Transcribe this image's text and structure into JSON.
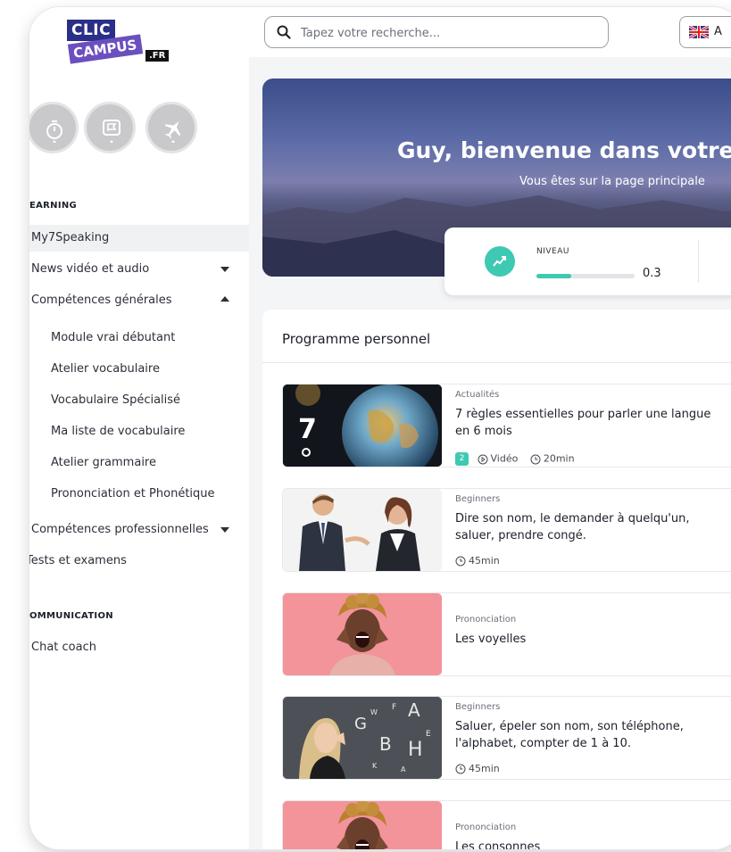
{
  "colors": {
    "accent": "#3ec9b2",
    "logo_blue": "#2a2f87",
    "logo_purple": "#6b4fbf"
  },
  "logo": {
    "line1": "CLIC",
    "line2": "CAMPUS",
    "suffix": ".FR"
  },
  "badges": [
    "timer-icon",
    "flag-icon",
    "plane-icon"
  ],
  "sidebar": {
    "section1": "EARNING",
    "items": [
      {
        "label": "My7Speaking",
        "active": true
      },
      {
        "label": "News vidéo et audio",
        "caret": "down"
      },
      {
        "label": "Compétences générales",
        "caret": "up"
      },
      {
        "label": "Module vrai débutant",
        "sub": true
      },
      {
        "label": "Atelier vocabulaire",
        "sub": true
      },
      {
        "label": "Vocabulaire Spécialisé",
        "sub": true
      },
      {
        "label": "Ma liste de vocabulaire",
        "sub": true
      },
      {
        "label": "Atelier grammaire",
        "sub": true
      },
      {
        "label": "Prononciation et Phonétique",
        "sub": true
      },
      {
        "label": "Compétences professionnelles",
        "caret": "down"
      },
      {
        "label": "Tests et examens"
      }
    ],
    "section2": "OMMUNICATION",
    "items2": [
      {
        "label": "Chat coach"
      }
    ]
  },
  "search": {
    "placeholder": "Tapez votre recherche..."
  },
  "language": {
    "label": "A"
  },
  "hero": {
    "title": "Guy, bienvenue dans votre in",
    "subtitle": "Vous êtes sur la page principale"
  },
  "level": {
    "label": "NIVEAU",
    "value": "0.3",
    "progress": 0.35
  },
  "program": {
    "title": "Programme personnel",
    "items": [
      {
        "category": "Actualités",
        "title": "7 règles essentielles pour parler une langue en 6 mois",
        "badge": "2",
        "type": "Vidéo",
        "duration": "20min"
      },
      {
        "category": "Beginners",
        "title": "Dire son nom, le demander à quelqu'un, saluer, prendre congé.",
        "duration": "45min"
      },
      {
        "category": "Prononciation",
        "title": "Les voyelles"
      },
      {
        "category": "Beginners",
        "title": "Saluer, épeler son nom, son téléphone, l'alphabet, compter de 1 à 10.",
        "duration": "45min"
      },
      {
        "category": "Prononciation",
        "title": "Les consonnes"
      }
    ]
  }
}
